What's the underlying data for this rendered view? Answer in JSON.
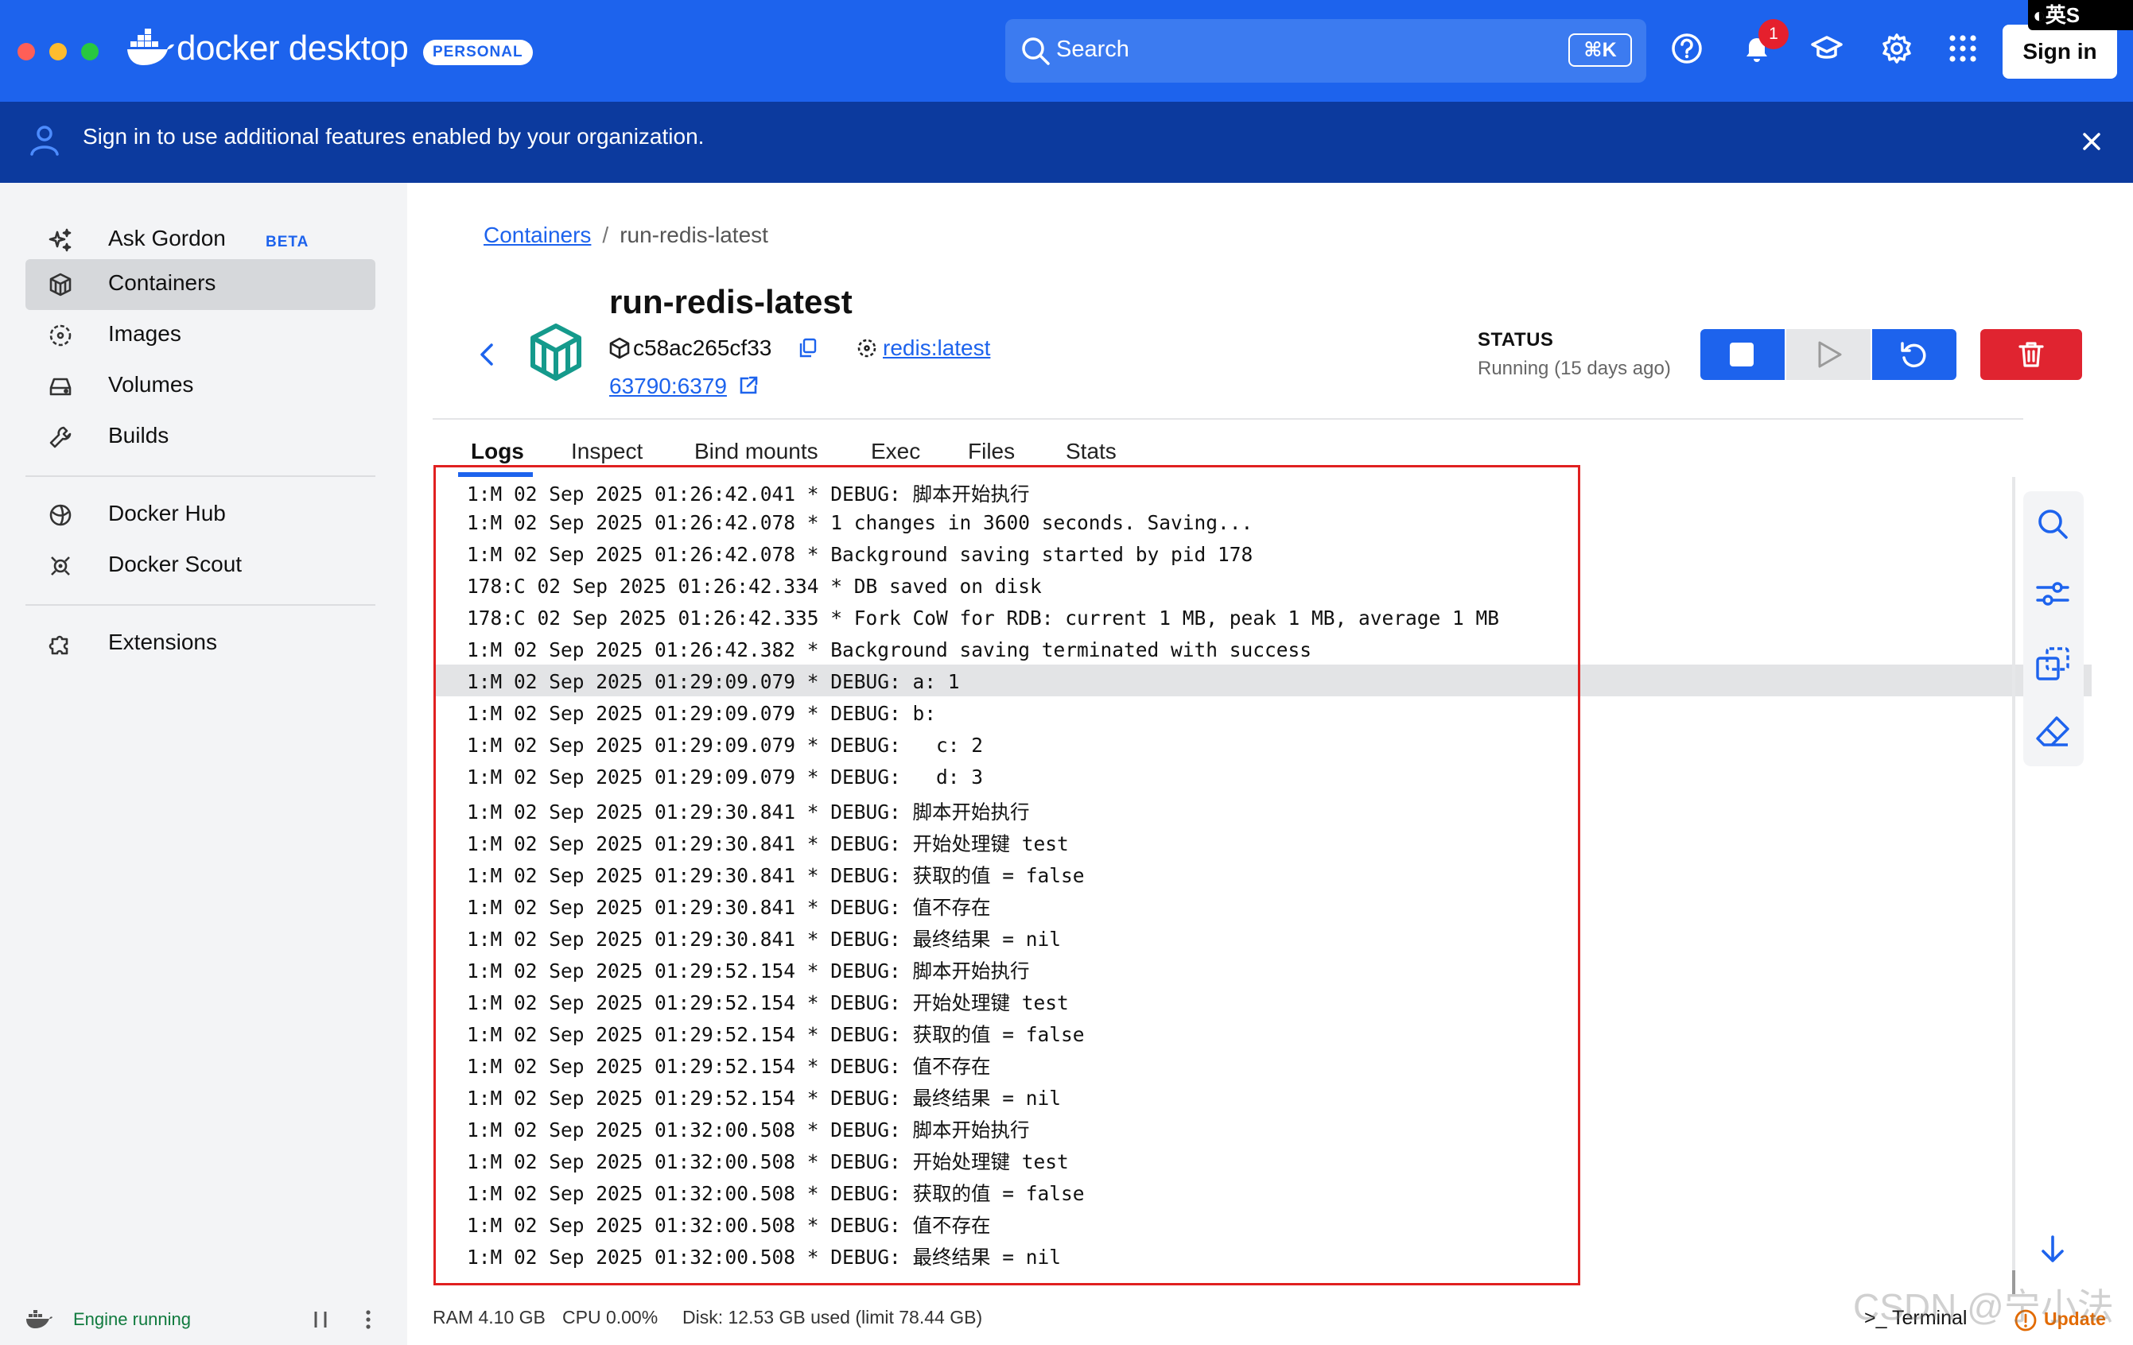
{
  "app": {
    "logo_text": "docker desktop",
    "plan_badge": "PERSONAL",
    "search_placeholder": "Search",
    "search_shortcut": "⌘K",
    "notification_count": "1",
    "sign_in_label": "Sign in",
    "ime_indicator": "◐英S"
  },
  "banner": {
    "text": "Sign in to use additional features enabled by your organization."
  },
  "sidebar": {
    "items": [
      {
        "label": "Ask Gordon",
        "badge": "BETA",
        "icon": "sparkle-icon"
      },
      {
        "label": "Containers",
        "icon": "container-icon",
        "active": true
      },
      {
        "label": "Images",
        "icon": "image-icon"
      },
      {
        "label": "Volumes",
        "icon": "volume-icon"
      },
      {
        "label": "Builds",
        "icon": "wrench-icon"
      },
      {
        "label": "Docker Hub",
        "icon": "hub-icon"
      },
      {
        "label": "Docker Scout",
        "icon": "scout-icon"
      },
      {
        "label": "Extensions",
        "icon": "puzzle-icon"
      }
    ],
    "engine_status": "Engine running"
  },
  "breadcrumb": {
    "parent": "Containers",
    "current": "run-redis-latest"
  },
  "container": {
    "name": "run-redis-latest",
    "id": "c58ac265cf33",
    "image": "redis:latest",
    "port": "63790:6379",
    "status_label": "STATUS",
    "status_value": "Running (15 days ago)"
  },
  "tabs": [
    "Logs",
    "Inspect",
    "Bind mounts",
    "Exec",
    "Files",
    "Stats"
  ],
  "logs": [
    "1:M 02 Sep 2025 01:26:42.041 * DEBUG: 脚本开始执行",
    "1:M 02 Sep 2025 01:26:42.078 * 1 changes in 3600 seconds. Saving...",
    "1:M 02 Sep 2025 01:26:42.078 * Background saving started by pid 178",
    "178:C 02 Sep 2025 01:26:42.334 * DB saved on disk",
    "178:C 02 Sep 2025 01:26:42.335 * Fork CoW for RDB: current 1 MB, peak 1 MB, average 1 MB",
    "1:M 02 Sep 2025 01:26:42.382 * Background saving terminated with success",
    "1:M 02 Sep 2025 01:29:09.079 * DEBUG: a: 1",
    "1:M 02 Sep 2025 01:29:09.079 * DEBUG: b:",
    "1:M 02 Sep 2025 01:29:09.079 * DEBUG:   c: 2",
    "1:M 02 Sep 2025 01:29:09.079 * DEBUG:   d: 3",
    "1:M 02 Sep 2025 01:29:30.841 * DEBUG: 脚本开始执行",
    "1:M 02 Sep 2025 01:29:30.841 * DEBUG: 开始处理键 test",
    "1:M 02 Sep 2025 01:29:30.841 * DEBUG: 获取的值 = false",
    "1:M 02 Sep 2025 01:29:30.841 * DEBUG: 值不存在",
    "1:M 02 Sep 2025 01:29:30.841 * DEBUG: 最终结果 = nil",
    "1:M 02 Sep 2025 01:29:52.154 * DEBUG: 脚本开始执行",
    "1:M 02 Sep 2025 01:29:52.154 * DEBUG: 开始处理键 test",
    "1:M 02 Sep 2025 01:29:52.154 * DEBUG: 获取的值 = false",
    "1:M 02 Sep 2025 01:29:52.154 * DEBUG: 值不存在",
    "1:M 02 Sep 2025 01:29:52.154 * DEBUG: 最终结果 = nil",
    "1:M 02 Sep 2025 01:32:00.508 * DEBUG: 脚本开始执行",
    "1:M 02 Sep 2025 01:32:00.508 * DEBUG: 开始处理键 test",
    "1:M 02 Sep 2025 01:32:00.508 * DEBUG: 获取的值 = false",
    "1:M 02 Sep 2025 01:32:00.508 * DEBUG: 值不存在",
    "1:M 02 Sep 2025 01:32:00.508 * DEBUG: 最终结果 = nil"
  ],
  "footer": {
    "ram": "RAM 4.10 GB",
    "cpu": "CPU 0.00%",
    "disk": "Disk: 12.53 GB used (limit 78.44 GB)",
    "terminal": ">_ Terminal",
    "update": "Update"
  },
  "watermark": "CSDN @宁小法",
  "colors": {
    "brand": "#1d63ed",
    "banner": "#0c3a9e",
    "danger": "#e02430",
    "highlight_box": "#e02020",
    "engine_ok": "#107a3e"
  }
}
